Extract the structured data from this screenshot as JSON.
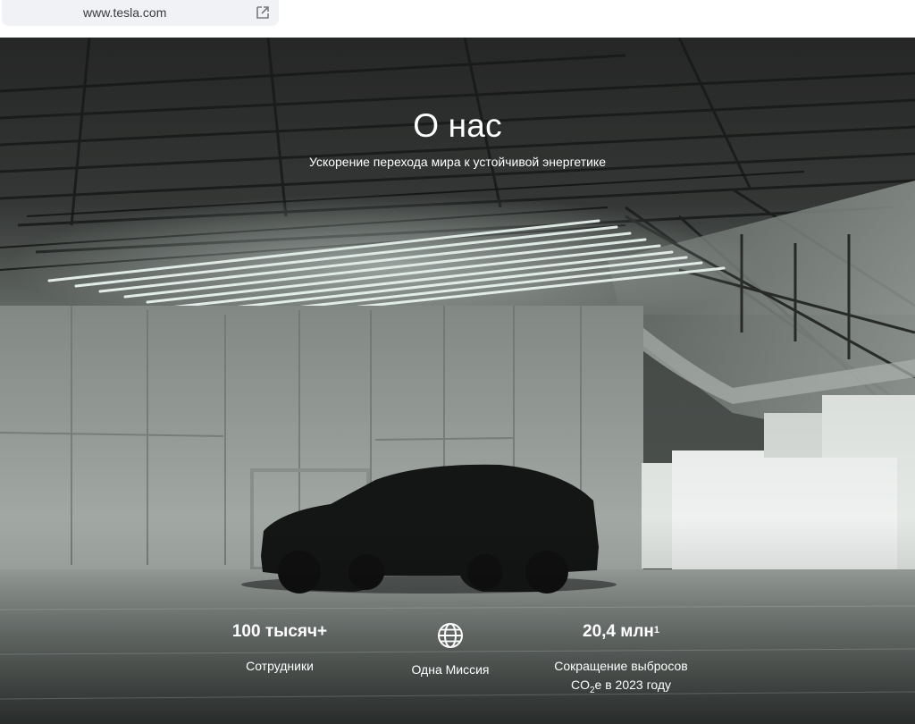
{
  "browser": {
    "url": "www.tesla.com",
    "open_external_icon": "open-external-icon"
  },
  "hero": {
    "title": "О нас",
    "subtitle": "Ускорение перехода мира к устойчивой энергетике"
  },
  "stats": [
    {
      "value": "100 тысяч+",
      "label": "Сотрудники"
    },
    {
      "icon": "globe-icon",
      "label": "Одна Миссия"
    },
    {
      "value": "20,4 млн",
      "footnote": "1",
      "label_line1": "Сокращение выбросов",
      "label_line2_prefix": "CO",
      "label_line2_sub": "2",
      "label_line2_suffix": "е в 2023 году"
    }
  ],
  "colors": {
    "text_on_hero": "#ffffff",
    "url_bar_bg": "#f1f2f6"
  }
}
